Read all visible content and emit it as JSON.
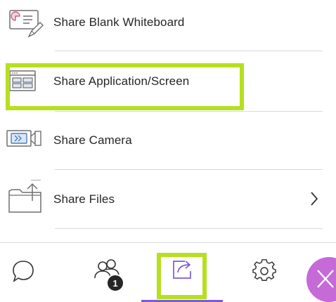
{
  "share_menu": {
    "items": [
      {
        "label": "Share Blank Whiteboard",
        "icon": "whiteboard-icon"
      },
      {
        "label": "Share Application/Screen",
        "icon": "screen-share-icon"
      },
      {
        "label": "Share Camera",
        "icon": "camera-icon"
      },
      {
        "label": "Share Files",
        "icon": "folder-upload-icon",
        "has_submenu": true
      }
    ]
  },
  "bottom_bar": {
    "tabs": [
      {
        "name": "chat",
        "icon": "chat-bubble-icon"
      },
      {
        "name": "attendees",
        "icon": "people-icon",
        "badge": "1"
      },
      {
        "name": "share-content",
        "icon": "share-icon",
        "active": true
      },
      {
        "name": "settings",
        "icon": "gear-icon"
      },
      {
        "name": "close",
        "icon": "close-icon"
      }
    ]
  },
  "colors": {
    "highlight": "#b6e01f",
    "accent": "#7e5bd6",
    "icon_blue": "#4a7fc1",
    "leave_button": "#c66ad8"
  }
}
